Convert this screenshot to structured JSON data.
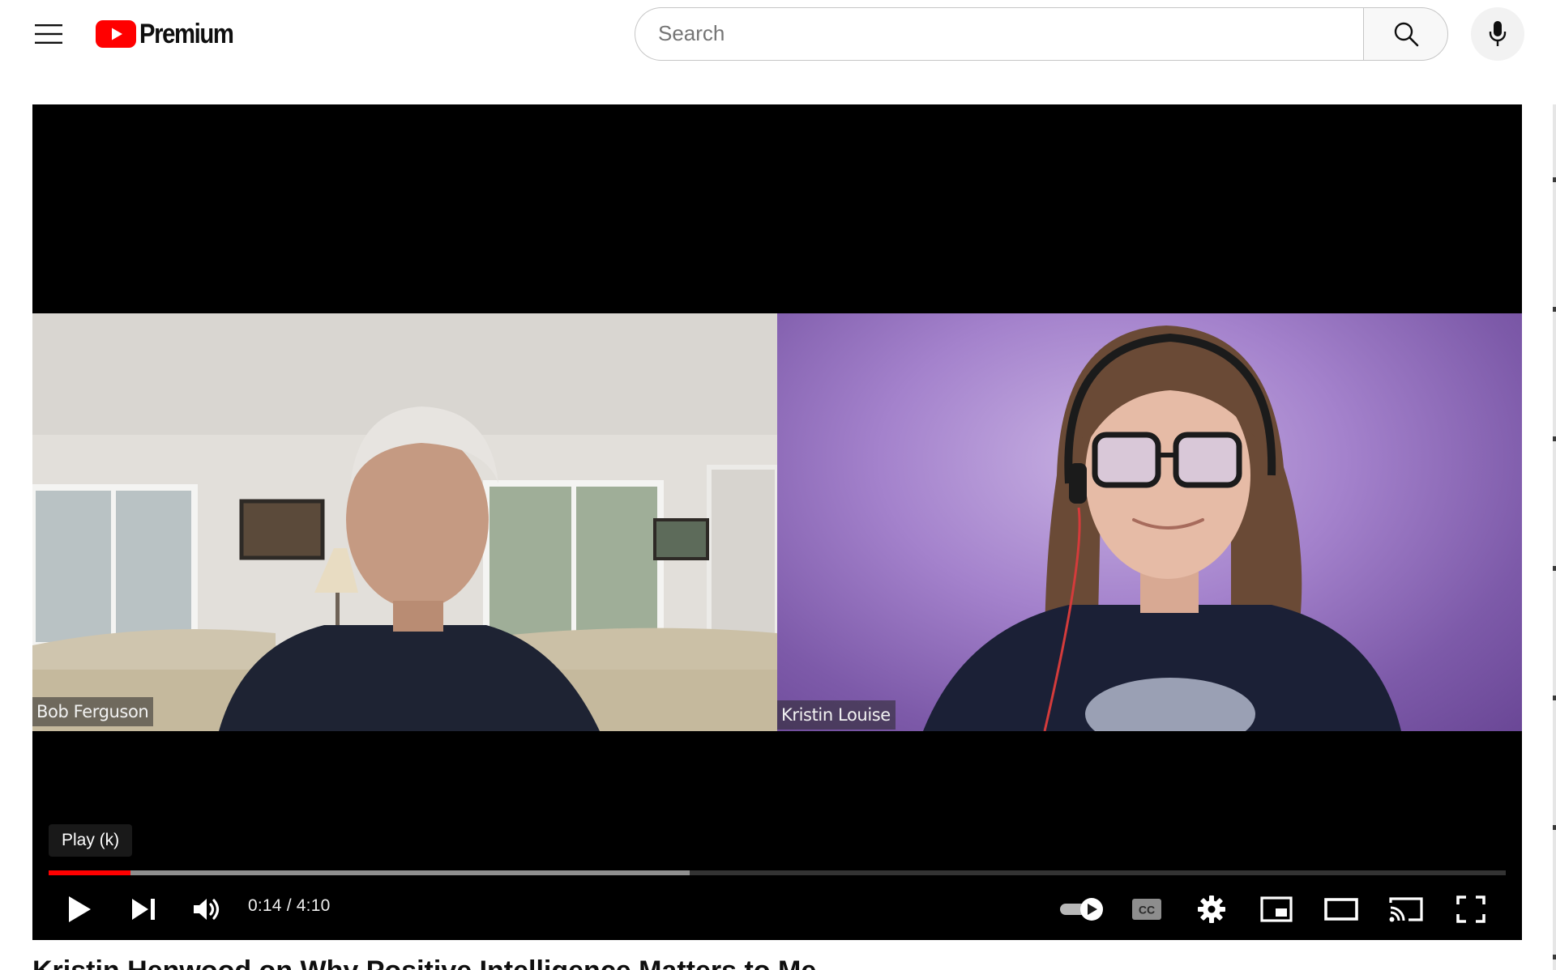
{
  "masthead": {
    "logo_text": "Premium",
    "search_placeholder": "Search",
    "search_value": ""
  },
  "player": {
    "participants": [
      {
        "name": "Bob Ferguson"
      },
      {
        "name": "Kristin Louise"
      }
    ],
    "tooltip": "Play (k)",
    "current_time": "0:14",
    "separator": " / ",
    "duration": "4:10",
    "played_fraction": 0.056,
    "loaded_fraction": 0.44,
    "autoplay_on": true
  },
  "video": {
    "title_partial": "Kristin Henwood on Why Positive Intelligence Matters to Me"
  },
  "colors": {
    "brand_red": "#FF0000",
    "player_bg": "#000000",
    "right_tile_purple": "#A482CC"
  },
  "icons": {
    "menu": "hamburger-menu-icon",
    "logo": "youtube-logo-icon",
    "search": "search-icon",
    "mic": "microphone-icon",
    "play": "play-icon",
    "next": "next-icon",
    "volume": "volume-icon",
    "autoplay": "autoplay-toggle-icon",
    "subtitles": "closed-captions-icon",
    "settings": "gear-icon",
    "miniplayer": "miniplayer-icon",
    "theater": "theater-mode-icon",
    "cast": "cast-icon",
    "fullscreen": "fullscreen-icon"
  }
}
